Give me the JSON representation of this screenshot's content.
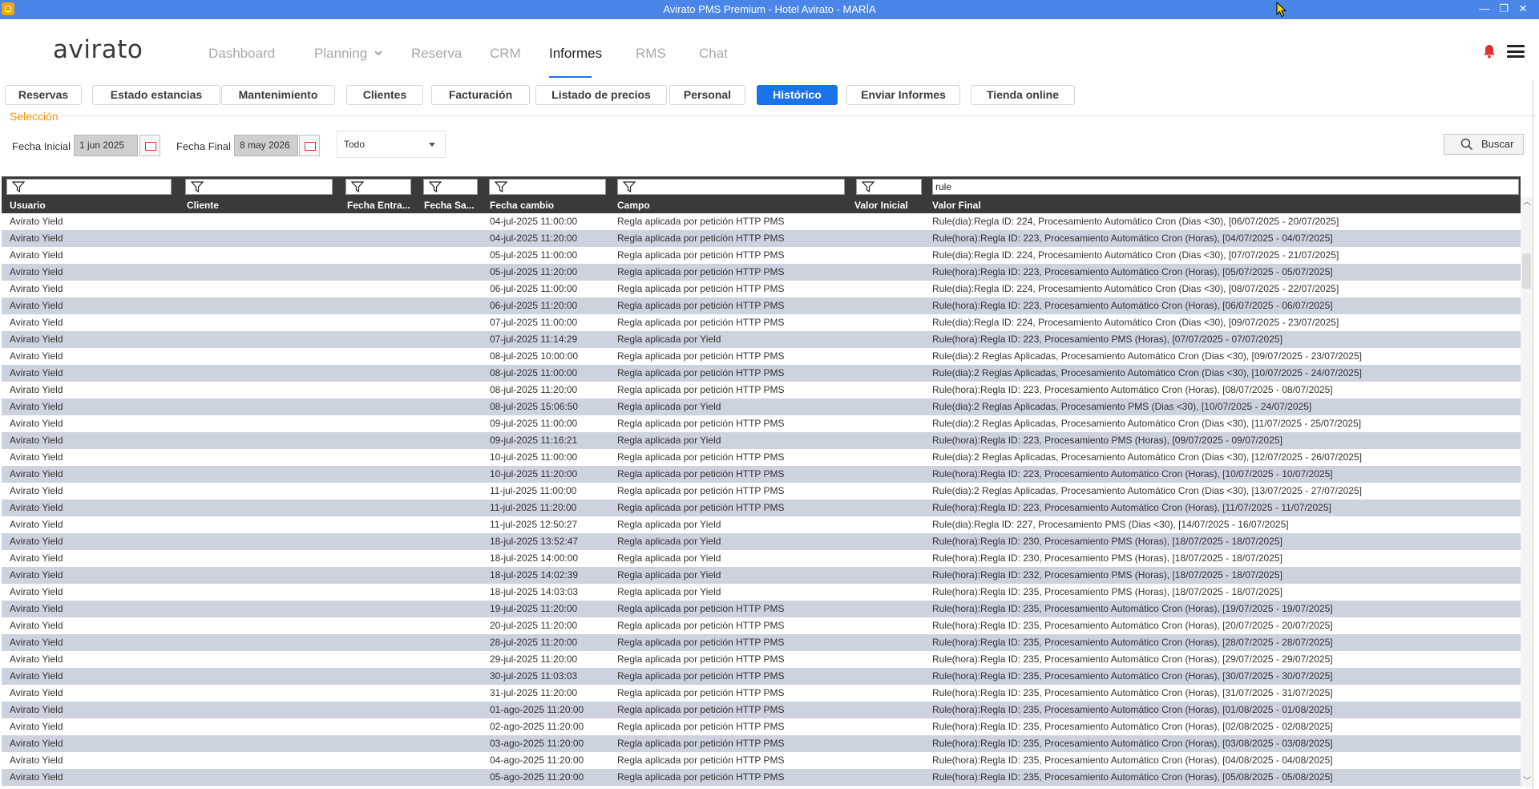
{
  "window": {
    "title": "Avirato PMS Premium - Hotel Avirato - MARÍA",
    "controls": {
      "minimize": "—",
      "maximize": "❐",
      "close": "✕"
    }
  },
  "nav": {
    "logo": "avirato",
    "items": [
      "Dashboard",
      "Planning",
      "Reserva",
      "CRM",
      "Informes",
      "RMS",
      "Chat"
    ],
    "active": "Informes"
  },
  "tabs": [
    "Reservas",
    "Estado estancias",
    "Mantenimiento",
    "Clientes",
    "Facturación",
    "Listado de precios",
    "Personal",
    "Histórico",
    "Enviar Informes",
    "Tienda online"
  ],
  "active_tab": "Histórico",
  "selection": {
    "title": "Selección",
    "start_label": "Fecha Inicial",
    "start_value": "1 jun 2025",
    "end_label": "Fecha Final",
    "end_value": "8 may 2026",
    "filter_select": "Todo",
    "search_label": "Buscar"
  },
  "grid": {
    "filters": [
      "",
      "",
      "",
      "",
      "",
      "",
      "",
      "rule"
    ],
    "columns": [
      "Usuario",
      "Cliente",
      "Fecha Entra...",
      "Fecha Sa...",
      "Fecha cambio",
      "Campo",
      "Valor Inicial",
      "Valor Final"
    ],
    "rows": [
      [
        "Avirato Yield",
        "",
        "",
        "",
        "04-jul-2025 11:00:00",
        "Regla aplicada por petición HTTP PMS",
        "",
        "Rule(dia):Regla ID: 224, Procesamiento Automático Cron (Dias <30), [06/07/2025 - 20/07/2025]"
      ],
      [
        "Avirato Yield",
        "",
        "",
        "",
        "04-jul-2025 11:20:00",
        "Regla aplicada por petición HTTP PMS",
        "",
        "Rule(hora):Regla ID: 223, Procesamiento Automático Cron (Horas), [04/07/2025 - 04/07/2025]"
      ],
      [
        "Avirato Yield",
        "",
        "",
        "",
        "05-jul-2025 11:00:00",
        "Regla aplicada por petición HTTP PMS",
        "",
        "Rule(dia):Regla ID: 224, Procesamiento Automático Cron (Dias <30), [07/07/2025 - 21/07/2025]"
      ],
      [
        "Avirato Yield",
        "",
        "",
        "",
        "05-jul-2025 11:20:00",
        "Regla aplicada por petición HTTP PMS",
        "",
        "Rule(hora):Regla ID: 223, Procesamiento Automático Cron (Horas), [05/07/2025 - 05/07/2025]"
      ],
      [
        "Avirato Yield",
        "",
        "",
        "",
        "06-jul-2025 11:00:00",
        "Regla aplicada por petición HTTP PMS",
        "",
        "Rule(dia):Regla ID: 224, Procesamiento Automático Cron (Dias <30), [08/07/2025 - 22/07/2025]"
      ],
      [
        "Avirato Yield",
        "",
        "",
        "",
        "06-jul-2025 11:20:00",
        "Regla aplicada por petición HTTP PMS",
        "",
        "Rule(hora):Regla ID: 223, Procesamiento Automático Cron (Horas), [06/07/2025 - 06/07/2025]"
      ],
      [
        "Avirato Yield",
        "",
        "",
        "",
        "07-jul-2025 11:00:00",
        "Regla aplicada por petición HTTP PMS",
        "",
        "Rule(dia):Regla ID: 224, Procesamiento Automático Cron (Dias <30), [09/07/2025 - 23/07/2025]"
      ],
      [
        "Avirato Yield",
        "",
        "",
        "",
        "07-jul-2025 11:14:29",
        "Regla aplicada por Yield",
        "",
        "Rule(hora):Regla ID: 223, Procesamiento PMS (Horas), [07/07/2025 - 07/07/2025]"
      ],
      [
        "Avirato Yield",
        "",
        "",
        "",
        "08-jul-2025 10:00:00",
        "Regla aplicada por petición HTTP PMS",
        "",
        "Rule(dia):2 Reglas Aplicadas, Procesamiento Automático Cron (Dias <30), [09/07/2025 - 23/07/2025]"
      ],
      [
        "Avirato Yield",
        "",
        "",
        "",
        "08-jul-2025 11:00:00",
        "Regla aplicada por petición HTTP PMS",
        "",
        "Rule(dia):2 Reglas Aplicadas, Procesamiento Automático Cron (Dias <30), [10/07/2025 - 24/07/2025]"
      ],
      [
        "Avirato Yield",
        "",
        "",
        "",
        "08-jul-2025 11:20:00",
        "Regla aplicada por petición HTTP PMS",
        "",
        "Rule(hora):Regla ID: 223, Procesamiento Automático Cron (Horas), [08/07/2025 - 08/07/2025]"
      ],
      [
        "Avirato Yield",
        "",
        "",
        "",
        "08-jul-2025 15:06:50",
        "Regla aplicada por Yield",
        "",
        "Rule(dia):2 Reglas Aplicadas, Procesamiento PMS (Dias <30), [10/07/2025 - 24/07/2025]"
      ],
      [
        "Avirato Yield",
        "",
        "",
        "",
        "09-jul-2025 11:00:00",
        "Regla aplicada por petición HTTP PMS",
        "",
        "Rule(dia):2 Reglas Aplicadas, Procesamiento Automático Cron (Dias <30), [11/07/2025 - 25/07/2025]"
      ],
      [
        "Avirato Yield",
        "",
        "",
        "",
        "09-jul-2025 11:16:21",
        "Regla aplicada por Yield",
        "",
        "Rule(hora):Regla ID: 223, Procesamiento PMS (Horas), [09/07/2025 - 09/07/2025]"
      ],
      [
        "Avirato Yield",
        "",
        "",
        "",
        "10-jul-2025 11:00:00",
        "Regla aplicada por petición HTTP PMS",
        "",
        "Rule(dia):2 Reglas Aplicadas, Procesamiento Automático Cron (Dias <30), [12/07/2025 - 26/07/2025]"
      ],
      [
        "Avirato Yield",
        "",
        "",
        "",
        "10-jul-2025 11:20:00",
        "Regla aplicada por petición HTTP PMS",
        "",
        "Rule(hora):Regla ID: 223, Procesamiento Automático Cron (Horas), [10/07/2025 - 10/07/2025]"
      ],
      [
        "Avirato Yield",
        "",
        "",
        "",
        "11-jul-2025 11:00:00",
        "Regla aplicada por petición HTTP PMS",
        "",
        "Rule(dia):2 Reglas Aplicadas, Procesamiento Automático Cron (Dias <30), [13/07/2025 - 27/07/2025]"
      ],
      [
        "Avirato Yield",
        "",
        "",
        "",
        "11-jul-2025 11:20:00",
        "Regla aplicada por petición HTTP PMS",
        "",
        "Rule(hora):Regla ID: 223, Procesamiento Automático Cron (Horas), [11/07/2025 - 11/07/2025]"
      ],
      [
        "Avirato Yield",
        "",
        "",
        "",
        "11-jul-2025 12:50:27",
        "Regla aplicada por Yield",
        "",
        "Rule(dia):Regla ID: 227, Procesamiento PMS (Dias <30), [14/07/2025 - 16/07/2025]"
      ],
      [
        "Avirato Yield",
        "",
        "",
        "",
        "18-jul-2025 13:52:47",
        "Regla aplicada por Yield",
        "",
        "Rule(hora):Regla ID: 230, Procesamiento PMS (Horas), [18/07/2025 - 18/07/2025]"
      ],
      [
        "Avirato Yield",
        "",
        "",
        "",
        "18-jul-2025 14:00:00",
        "Regla aplicada por Yield",
        "",
        "Rule(hora):Regla ID: 230, Procesamiento PMS (Horas), [18/07/2025 - 18/07/2025]"
      ],
      [
        "Avirato Yield",
        "",
        "",
        "",
        "18-jul-2025 14:02:39",
        "Regla aplicada por Yield",
        "",
        "Rule(hora):Regla ID: 232, Procesamiento PMS (Horas), [18/07/2025 - 18/07/2025]"
      ],
      [
        "Avirato Yield",
        "",
        "",
        "",
        "18-jul-2025 14:03:03",
        "Regla aplicada por Yield",
        "",
        "Rule(hora):Regla ID: 235, Procesamiento PMS (Horas), [18/07/2025 - 18/07/2025]"
      ],
      [
        "Avirato Yield",
        "",
        "",
        "",
        "19-jul-2025 11:20:00",
        "Regla aplicada por petición HTTP PMS",
        "",
        "Rule(hora):Regla ID: 235, Procesamiento Automático Cron (Horas), [19/07/2025 - 19/07/2025]"
      ],
      [
        "Avirato Yield",
        "",
        "",
        "",
        "20-jul-2025 11:20:00",
        "Regla aplicada por petición HTTP PMS",
        "",
        "Rule(hora):Regla ID: 235, Procesamiento Automático Cron (Horas), [20/07/2025 - 20/07/2025]"
      ],
      [
        "Avirato Yield",
        "",
        "",
        "",
        "28-jul-2025 11:20:00",
        "Regla aplicada por petición HTTP PMS",
        "",
        "Rule(hora):Regla ID: 235, Procesamiento Automático Cron (Horas), [28/07/2025 - 28/07/2025]"
      ],
      [
        "Avirato Yield",
        "",
        "",
        "",
        "29-jul-2025 11:20:00",
        "Regla aplicada por petición HTTP PMS",
        "",
        "Rule(hora):Regla ID: 235, Procesamiento Automático Cron (Horas), [29/07/2025 - 29/07/2025]"
      ],
      [
        "Avirato Yield",
        "",
        "",
        "",
        "30-jul-2025 11:03:03",
        "Regla aplicada por petición HTTP PMS",
        "",
        "Rule(hora):Regla ID: 235, Procesamiento Automático Cron (Horas), [30/07/2025 - 30/07/2025]"
      ],
      [
        "Avirato Yield",
        "",
        "",
        "",
        "31-jul-2025 11:20:00",
        "Regla aplicada por petición HTTP PMS",
        "",
        "Rule(hora):Regla ID: 235, Procesamiento Automático Cron (Horas), [31/07/2025 - 31/07/2025]"
      ],
      [
        "Avirato Yield",
        "",
        "",
        "",
        "01-ago-2025 11:20:00",
        "Regla aplicada por petición HTTP PMS",
        "",
        "Rule(hora):Regla ID: 235, Procesamiento Automático Cron (Horas), [01/08/2025 - 01/08/2025]"
      ],
      [
        "Avirato Yield",
        "",
        "",
        "",
        "02-ago-2025 11:20:00",
        "Regla aplicada por petición HTTP PMS",
        "",
        "Rule(hora):Regla ID: 235, Procesamiento Automático Cron (Horas), [02/08/2025 - 02/08/2025]"
      ],
      [
        "Avirato Yield",
        "",
        "",
        "",
        "03-ago-2025 11:20:00",
        "Regla aplicada por petición HTTP PMS",
        "",
        "Rule(hora):Regla ID: 235, Procesamiento Automático Cron (Horas), [03/08/2025 - 03/08/2025]"
      ],
      [
        "Avirato Yield",
        "",
        "",
        "",
        "04-ago-2025 11:20:00",
        "Regla aplicada por petición HTTP PMS",
        "",
        "Rule(hora):Regla ID: 235, Procesamiento Automático Cron (Horas), [04/08/2025 - 04/08/2025]"
      ],
      [
        "Avirato Yield",
        "",
        "",
        "",
        "05-ago-2025 11:20:00",
        "Regla aplicada por petición HTTP PMS",
        "",
        "Rule(hora):Regla ID: 235, Procesamiento Automático Cron (Horas), [05/08/2025 - 05/08/2025]"
      ]
    ]
  },
  "colors": {
    "titlebar": "#4a86e8",
    "accent": "#1a73e8",
    "section_title": "#f39200",
    "grid_header": "#3a3a3a",
    "row_alt": "#cdd2df",
    "bell": "#e03131"
  },
  "icons": {
    "app": "avirato-app-icon",
    "bell": "bell-icon",
    "menu": "hamburger-menu-icon",
    "calendar": "calendar-icon",
    "search": "search-icon",
    "filter": "filter-funnel-icon",
    "dropdown": "chevron-down-icon"
  }
}
